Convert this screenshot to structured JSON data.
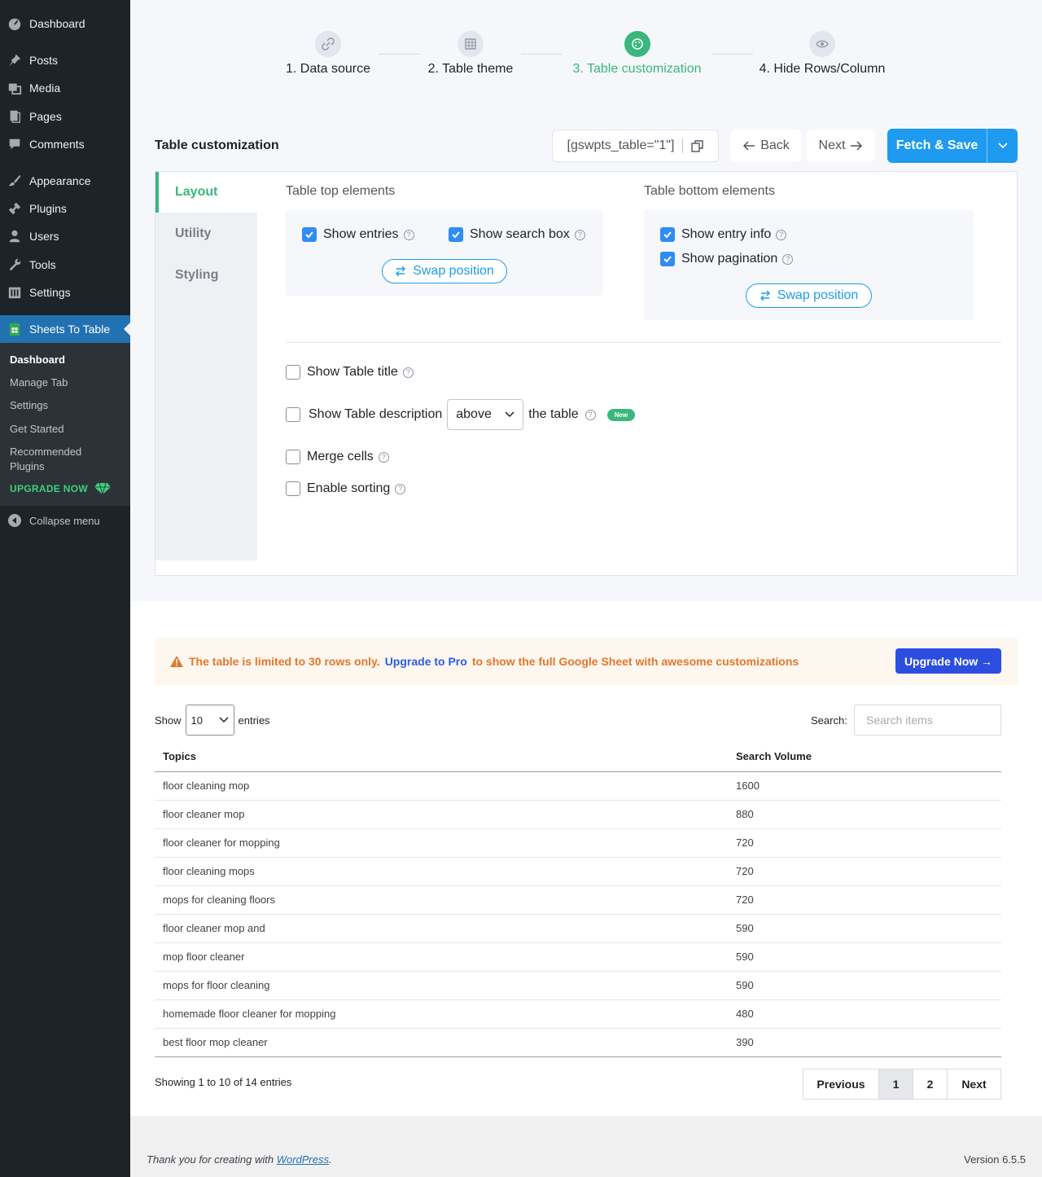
{
  "sidebar": {
    "items": [
      {
        "label": "Dashboard",
        "icon": "dashboard-icon"
      },
      {
        "label": "Posts",
        "icon": "pin-icon"
      },
      {
        "label": "Media",
        "icon": "media-icon"
      },
      {
        "label": "Pages",
        "icon": "pages-icon"
      },
      {
        "label": "Comments",
        "icon": "comments-icon"
      },
      {
        "label": "Appearance",
        "icon": "brush-icon"
      },
      {
        "label": "Plugins",
        "icon": "plugin-icon"
      },
      {
        "label": "Users",
        "icon": "user-icon"
      },
      {
        "label": "Tools",
        "icon": "wrench-icon"
      },
      {
        "label": "Settings",
        "icon": "settings-icon"
      },
      {
        "label": "Sheets To Table",
        "icon": "sheets-icon"
      }
    ],
    "submenu": [
      "Dashboard",
      "Manage Tab",
      "Settings",
      "Get Started",
      "Recommended",
      "Plugins"
    ],
    "upgrade_label": "UPGRADE NOW",
    "collapse_label": "Collapse menu"
  },
  "steps": [
    "1. Data source",
    "2. Table theme",
    "3. Table customization",
    "4. Hide Rows/Column"
  ],
  "header": {
    "title": "Table customization",
    "shortcode": "[gswpts_table=\"1\"]",
    "back_label": "Back",
    "next_label": "Next",
    "fetch_label": "Fetch & Save"
  },
  "tabs": [
    "Layout",
    "Utility",
    "Styling"
  ],
  "layout": {
    "top_title": "Table top elements",
    "bottom_title": "Table bottom elements",
    "show_entries": "Show entries",
    "show_search": "Show search box",
    "show_entry_info": "Show entry info",
    "show_pagination": "Show pagination",
    "swap": "Swap position",
    "show_title": "Show Table title",
    "show_desc": "Show Table description",
    "desc_position": "above",
    "desc_suffix": "the table",
    "new_badge": "New",
    "merge_cells": "Merge cells",
    "enable_sorting": "Enable sorting"
  },
  "preview": {
    "notice_text": "The table is limited to 30 rows only.",
    "notice_link": "Upgrade to Pro",
    "notice_suffix": "to show the full Google Sheet with awesome customizations",
    "upgrade_btn": "Upgrade Now →",
    "show_label": "Show",
    "entries_value": "10",
    "entries_label": "entries",
    "search_label": "Search:",
    "search_placeholder": "Search items",
    "columns": [
      "Topics",
      "Search Volume"
    ],
    "rows": [
      [
        "floor cleaning mop",
        "1600"
      ],
      [
        "floor cleaner mop",
        "880"
      ],
      [
        "floor cleaner for mopping",
        "720"
      ],
      [
        "floor cleaning mops",
        "720"
      ],
      [
        "mops for cleaning floors",
        "720"
      ],
      [
        "floor cleaner mop and",
        "590"
      ],
      [
        "mop floor cleaner",
        "590"
      ],
      [
        "mops for floor cleaning",
        "590"
      ],
      [
        "homemade floor cleaner for mopping",
        "480"
      ],
      [
        "best floor mop cleaner",
        "390"
      ]
    ],
    "info": "Showing 1 to 10 of 14 entries",
    "pager": [
      "Previous",
      "1",
      "2",
      "Next"
    ]
  },
  "footer": {
    "thanks": "Thank you for creating with",
    "wp": "WordPress",
    "period": ".",
    "version": "Version 6.5.5"
  },
  "colors": {
    "accent": "#39b77c",
    "primary": "#1e9bf0",
    "admin_bg": "#1d2327",
    "menu_active": "#2271b1"
  }
}
